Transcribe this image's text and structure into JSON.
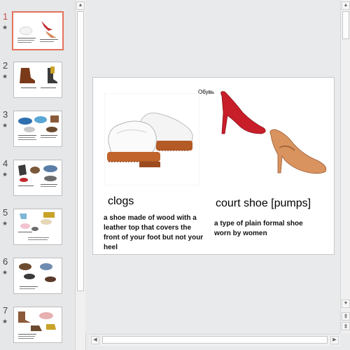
{
  "thumbnails": [
    {
      "number": "1",
      "active": true
    },
    {
      "number": "2",
      "active": false
    },
    {
      "number": "3",
      "active": false
    },
    {
      "number": "4",
      "active": false
    },
    {
      "number": "5",
      "active": false
    },
    {
      "number": "6",
      "active": false
    },
    {
      "number": "7",
      "active": false
    }
  ],
  "thumbnail_star": "★",
  "slide": {
    "title": "Обувь",
    "left": {
      "heading": "clogs",
      "description": "a shoe made of wood with a leather top that covers the front of your foot but not your heel"
    },
    "right": {
      "heading": "court shoe [pumps]",
      "description": "a type of plain formal shoe worn by women"
    }
  },
  "colors": {
    "active_thumbnail_border": "#e2725b",
    "active_number": "#c0504d"
  },
  "icons": {
    "scroll_up": "▲",
    "scroll_down": "▼",
    "scroll_left": "◀",
    "scroll_right": "▶",
    "prev_slide": "⇞",
    "next_slide": "⇟"
  }
}
